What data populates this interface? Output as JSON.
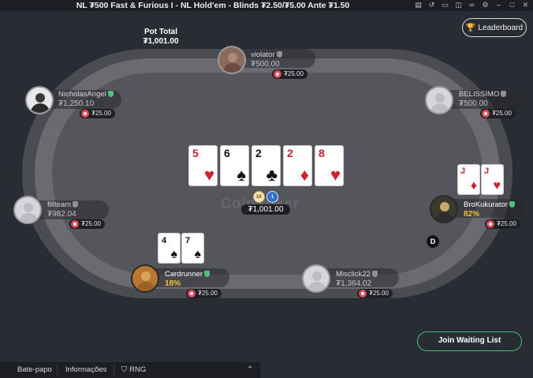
{
  "window": {
    "title": "NL ₮500 Fast & Furious I - NL Hold'em - Blinds ₮2.50/₮5.00 Ante ₮1.50",
    "icons": [
      "notes-icon",
      "history-icon",
      "folder-icon",
      "window-icon",
      "link-icon",
      "settings-icon",
      "minimize-icon",
      "maximize-icon",
      "close-icon"
    ]
  },
  "header": {
    "leaderboard_label": "Leaderboard"
  },
  "pot": {
    "label": "Pot Total",
    "total": "₮1,001.00",
    "center_amount": "₮1,001.00"
  },
  "watermark": "CoinPoker",
  "chips": {
    "token1": "1K",
    "token2": "1"
  },
  "board": [
    {
      "rank": "5",
      "suit": "♥",
      "color": "red"
    },
    {
      "rank": "6",
      "suit": "♠",
      "color": "black"
    },
    {
      "rank": "2",
      "suit": "♣",
      "color": "black"
    },
    {
      "rank": "2",
      "suit": "♦",
      "color": "red"
    },
    {
      "rank": "8",
      "suit": "♥",
      "color": "red"
    }
  ],
  "players": {
    "violator": {
      "name": "violator",
      "stack": "₮500.00",
      "bet": "₮25.00"
    },
    "nicholas": {
      "name": "NicholasAngel",
      "stack": "₮1,250.10",
      "bet": "₮25.00"
    },
    "belissimo": {
      "name": "BELISSIMO",
      "stack": "₮500.00",
      "bet": "₮25.00"
    },
    "fillteam": {
      "name": "fillteam",
      "stack": "₮982.04",
      "bet": "₮25.00"
    },
    "brokukurator": {
      "name": "BroKukurator",
      "equity": "82%",
      "bet": "₮25.00",
      "cards": [
        {
          "rank": "J",
          "suit": "♦",
          "color": "red"
        },
        {
          "rank": "J",
          "suit": "♥",
          "color": "red"
        }
      ]
    },
    "cardrunner": {
      "name": "Cardrunner",
      "equity": "18%",
      "bet": "₮25.00",
      "cards": [
        {
          "rank": "4",
          "suit": "♠",
          "color": "black"
        },
        {
          "rank": "7",
          "suit": "♠",
          "color": "black"
        }
      ]
    },
    "misclick": {
      "name": "Misclick22",
      "stack": "₮1,364.02",
      "bet": "₮25.00"
    }
  },
  "dealer_label": "D",
  "join_label": "Join Waiting List",
  "bottom_tabs": {
    "chat": "Bate-papo",
    "info": "Informações",
    "rng": "RNG"
  },
  "colors": {
    "accent_green": "#3fbf74",
    "equity_yellow": "#f0c23b",
    "chip_red": "#e24a5a"
  }
}
